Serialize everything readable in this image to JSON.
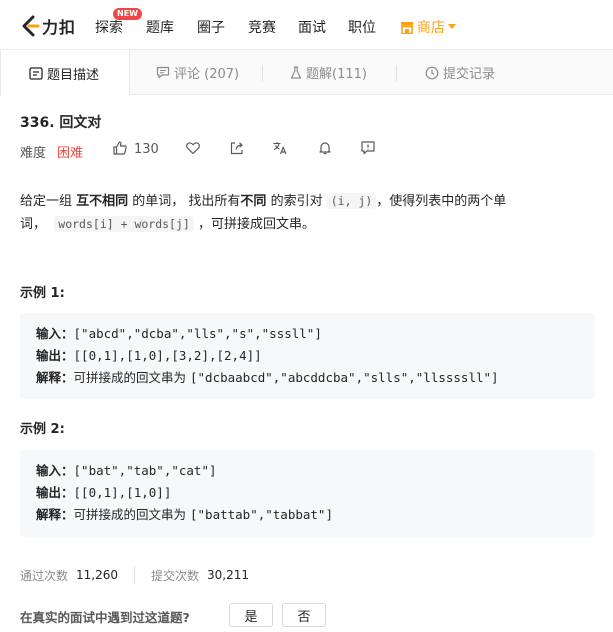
{
  "nav": {
    "brand": "力扣",
    "items": [
      "探索",
      "题库",
      "圈子",
      "竞赛",
      "面试",
      "职位"
    ],
    "new_badge": "NEW",
    "shop": "商店",
    "accent": "#ffa116"
  },
  "tabs": [
    {
      "label": "题目描述",
      "icon": "document-icon"
    },
    {
      "label": "评论 (207)",
      "icon": "comment-icon"
    },
    {
      "label": "题解(111)",
      "icon": "flask-icon"
    },
    {
      "label": "提交记录",
      "icon": "clock-icon"
    }
  ],
  "problem": {
    "title": "336. 回文对",
    "difficulty_label": "难度",
    "difficulty": "困难",
    "likes": "130",
    "desc_1": "给定一组 ",
    "desc_b1": "互不相同",
    "desc_2": " 的单词， 找出所有",
    "desc_b2": "不同",
    "desc_3": " 的索引对",
    "desc_code1": "(i, j)",
    "desc_4": "，使得列表中的两个单",
    "desc_5": "词，",
    "desc_code2": "words[i] + words[j]",
    "desc_6": "，可拼接成回文串。"
  },
  "examples": [
    {
      "title": "示例 1:",
      "input_label": "输入：",
      "input": "[\"abcd\",\"dcba\",\"lls\",\"s\",\"sssll\"]",
      "output_label": "输出：",
      "output": "[[0,1],[1,0],[3,2],[2,4]]",
      "explain_label": "解释：",
      "explain_text": "可拼接成的回文串为 ",
      "explain_code": "[\"dcbaabcd\",\"abcddcba\",\"slls\",\"llssssll\"]"
    },
    {
      "title": "示例 2:",
      "input_label": "输入：",
      "input": "[\"bat\",\"tab\",\"cat\"]",
      "output_label": "输出：",
      "output": "[[0,1],[1,0]]",
      "explain_label": "解释：",
      "explain_text": "可拼接成的回文串为 ",
      "explain_code": "[\"battab\",\"tabbat\"]"
    }
  ],
  "stats": {
    "accepted_label": "通过次数",
    "accepted": "11,260",
    "submissions_label": "提交次数",
    "submissions": "30,211"
  },
  "feedback": {
    "question": "在真实的面试中遇到过这道题?",
    "yes": "是",
    "no": "否"
  }
}
